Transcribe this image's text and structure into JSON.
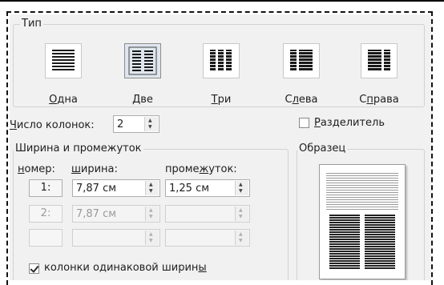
{
  "type_group": {
    "title": "Тип",
    "options": [
      {
        "pre": "",
        "accel": "О",
        "post": "дна"
      },
      {
        "pre": "",
        "accel": "Д",
        "post": "ве"
      },
      {
        "pre": "",
        "accel": "Т",
        "post": "ри"
      },
      {
        "pre": "С",
        "accel": "л",
        "post": "ева"
      },
      {
        "pre": "С",
        "accel": "п",
        "post": "рава"
      }
    ],
    "selected": "Две"
  },
  "columns_count": {
    "accel": "Ч",
    "label_rest": "исло колонок:",
    "value": "2"
  },
  "separator": {
    "accel": "Р",
    "label_rest": "азделитель",
    "checked": false
  },
  "width_group": {
    "title": "Ширина и промежуток",
    "headers": {
      "num_accel": "н",
      "num_rest": "омер:",
      "width_accel": "ш",
      "width_rest": "ирина:",
      "gap_pre": "проме",
      "gap_accel": "ж",
      "gap_rest": "уток:"
    },
    "rows": [
      {
        "num": "1:",
        "width": "7,87 см",
        "gap": "1,25 см",
        "enabled": true
      },
      {
        "num": "2:",
        "width": "7,87 см",
        "gap": "",
        "enabled": false
      },
      {
        "num": "",
        "width": "",
        "gap": "",
        "enabled": false
      }
    ]
  },
  "equal_width": {
    "label_pre": "колонки одинаковой ширин",
    "accel": "ы",
    "checked": true
  },
  "sample": {
    "title": "Образец"
  }
}
